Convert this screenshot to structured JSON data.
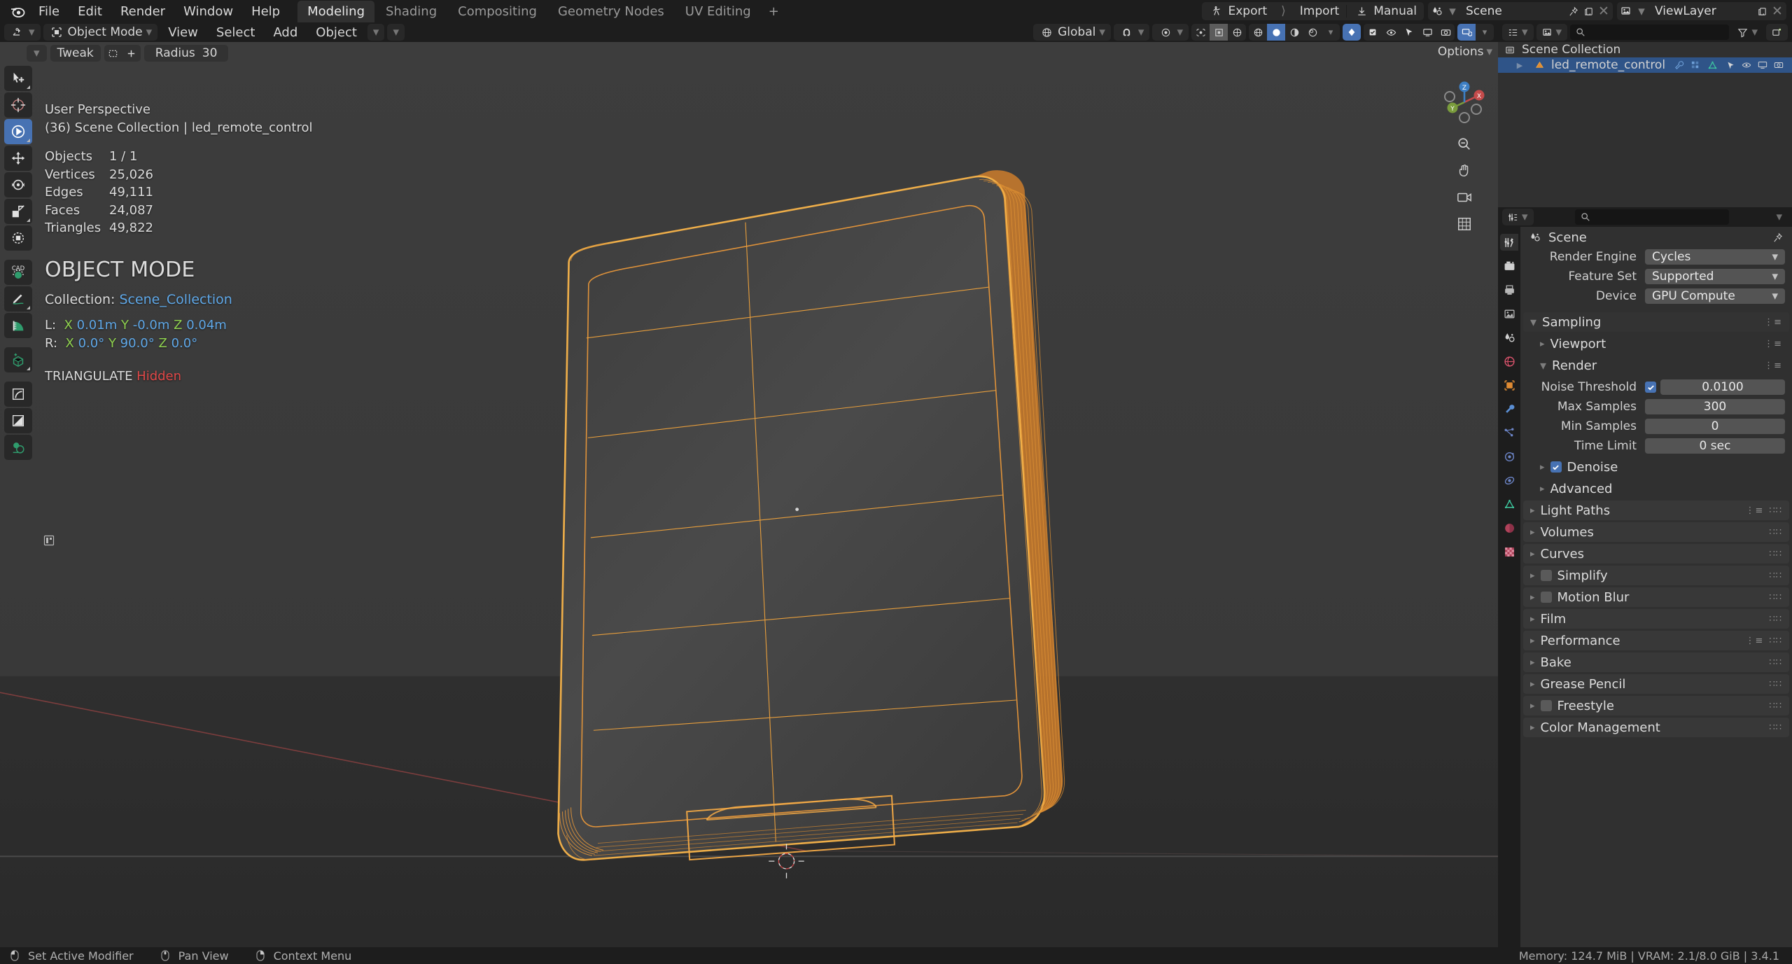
{
  "app": {
    "menus": [
      "File",
      "Edit",
      "Render",
      "Window",
      "Help"
    ],
    "workspace_tabs": [
      {
        "label": "Modeling",
        "active": true
      },
      {
        "label": "Shading",
        "active": false
      },
      {
        "label": "Compositing",
        "active": false
      },
      {
        "label": "Geometry Nodes",
        "active": false
      },
      {
        "label": "UV Editing",
        "active": false
      },
      {
        "label": "+",
        "active": false
      }
    ],
    "topbar_right": {
      "export_label": "Export",
      "import_label": "Import",
      "manual_label": "Manual",
      "scene_name": "Scene",
      "viewlayer_name": "ViewLayer"
    }
  },
  "viewport_header": {
    "mode": "Object Mode",
    "menus": [
      "View",
      "Select",
      "Add",
      "Object"
    ],
    "transform_orientation": "Global"
  },
  "tool_settings": {
    "tweak_label": "Tweak",
    "radius_label": "Radius",
    "radius_value": "30"
  },
  "viewport": {
    "options_label": "Options",
    "perspective": "User Perspective",
    "context_line": "(36) Scene Collection | led_remote_control",
    "stats": [
      {
        "label": "Objects",
        "value": "1 / 1"
      },
      {
        "label": "Vertices",
        "value": "25,026"
      },
      {
        "label": "Edges",
        "value": "49,111"
      },
      {
        "label": "Faces",
        "value": "24,087"
      },
      {
        "label": "Triangles",
        "value": "49,822"
      }
    ],
    "mode_title": "OBJECT MODE",
    "collection_label": "Collection:",
    "collection_name": "Scene_Collection",
    "loc": {
      "prefix": "L:",
      "x_axis": "X",
      "x_val": "0.01m",
      "y_axis": "Y",
      "y_val": "-0.0m",
      "z_axis": "Z",
      "z_val": "0.04m"
    },
    "rot": {
      "prefix": "R:",
      "x_axis": "X",
      "x_val": "0.0°",
      "y_axis": "Y",
      "y_val": "90.0°",
      "z_axis": "Z",
      "z_val": "0.0°"
    },
    "modifier_name": "TRIANGULATE",
    "modifier_state": "Hidden",
    "gizmo_axes": [
      "X",
      "Y",
      "Z"
    ]
  },
  "toolbar": {
    "tools": [
      {
        "name": "tweak-tool",
        "selected": false
      },
      {
        "name": "cursor-tool",
        "selected": false
      },
      {
        "name": "select-box-tool",
        "selected": true
      },
      {
        "name": "move-tool",
        "selected": false
      },
      {
        "name": "rotate-tool",
        "selected": false
      },
      {
        "name": "scale-tool",
        "selected": false
      },
      {
        "name": "transform-tool",
        "selected": false
      },
      {
        "name": "cad-transform-tool",
        "selected": false
      },
      {
        "name": "annotate-tool",
        "selected": false
      },
      {
        "name": "measure-tool",
        "selected": false
      },
      {
        "name": "add-cube-tool",
        "selected": false
      },
      {
        "name": "bevel-tool",
        "selected": false
      },
      {
        "name": "shear-tool",
        "selected": false
      },
      {
        "name": "mirror-tool",
        "selected": false
      }
    ]
  },
  "outliner": {
    "root_label": "Scene Collection",
    "search_placeholder": "",
    "items": [
      {
        "label": "led_remote_control",
        "selected": true
      }
    ]
  },
  "properties": {
    "breadcrumb": "Scene",
    "search_placeholder": "",
    "rows": [
      {
        "label": "Render Engine",
        "value": "Cycles"
      },
      {
        "label": "Feature Set",
        "value": "Supported"
      },
      {
        "label": "Device",
        "value": "GPU Compute"
      }
    ],
    "sampling": {
      "title": "Sampling",
      "viewport": "Viewport",
      "render": "Render",
      "noise_threshold_label": "Noise Threshold",
      "noise_threshold_value": "0.0100",
      "noise_threshold_enabled": true,
      "max_samples_label": "Max Samples",
      "max_samples_value": "300",
      "min_samples_label": "Min Samples",
      "min_samples_value": "0",
      "time_limit_label": "Time Limit",
      "time_limit_value": "0 sec",
      "denoise_label": "Denoise",
      "denoise_enabled": true,
      "advanced": "Advanced"
    },
    "panels": [
      {
        "label": "Light Paths",
        "checkbox": null,
        "has_preset": true
      },
      {
        "label": "Volumes",
        "checkbox": null,
        "has_preset": false
      },
      {
        "label": "Curves",
        "checkbox": null,
        "has_preset": false
      },
      {
        "label": "Simplify",
        "checkbox": false,
        "has_preset": false
      },
      {
        "label": "Motion Blur",
        "checkbox": false,
        "has_preset": false
      },
      {
        "label": "Film",
        "checkbox": null,
        "has_preset": false
      },
      {
        "label": "Performance",
        "checkbox": null,
        "has_preset": true
      },
      {
        "label": "Bake",
        "checkbox": null,
        "has_preset": false
      },
      {
        "label": "Grease Pencil",
        "checkbox": null,
        "has_preset": false
      },
      {
        "label": "Freestyle",
        "checkbox": false,
        "has_preset": false
      },
      {
        "label": "Color Management",
        "checkbox": null,
        "has_preset": false
      }
    ],
    "tabs": [
      {
        "name": "tool-tab",
        "active": true
      },
      {
        "name": "render-tab",
        "active": false
      },
      {
        "name": "output-tab",
        "active": false
      },
      {
        "name": "view-layer-tab",
        "active": false
      },
      {
        "name": "scene-tab",
        "active": false
      },
      {
        "name": "world-tab",
        "active": false
      },
      {
        "name": "object-tab",
        "active": false
      },
      {
        "name": "modifier-tab",
        "active": false
      },
      {
        "name": "particles-tab",
        "active": false
      },
      {
        "name": "physics-tab",
        "active": false
      },
      {
        "name": "constraints-tab",
        "active": false
      },
      {
        "name": "data-tab",
        "active": false
      },
      {
        "name": "material-tab",
        "active": false
      },
      {
        "name": "texture-tab",
        "active": false
      }
    ]
  },
  "statusbar": {
    "items": [
      {
        "label": "Set Active Modifier"
      },
      {
        "label": "Pan View"
      },
      {
        "label": "Context Menu"
      }
    ],
    "system": "Memory: 124.7 MiB | VRAM: 2.1/8.0 GiB | 3.4.1"
  },
  "colors": {
    "accent_blue": "#4772b3",
    "selection_orange": "#f2a33c",
    "axis_x": "#8fd14f",
    "axis_value": "#5fa8e8",
    "warning_red": "#e04848"
  }
}
